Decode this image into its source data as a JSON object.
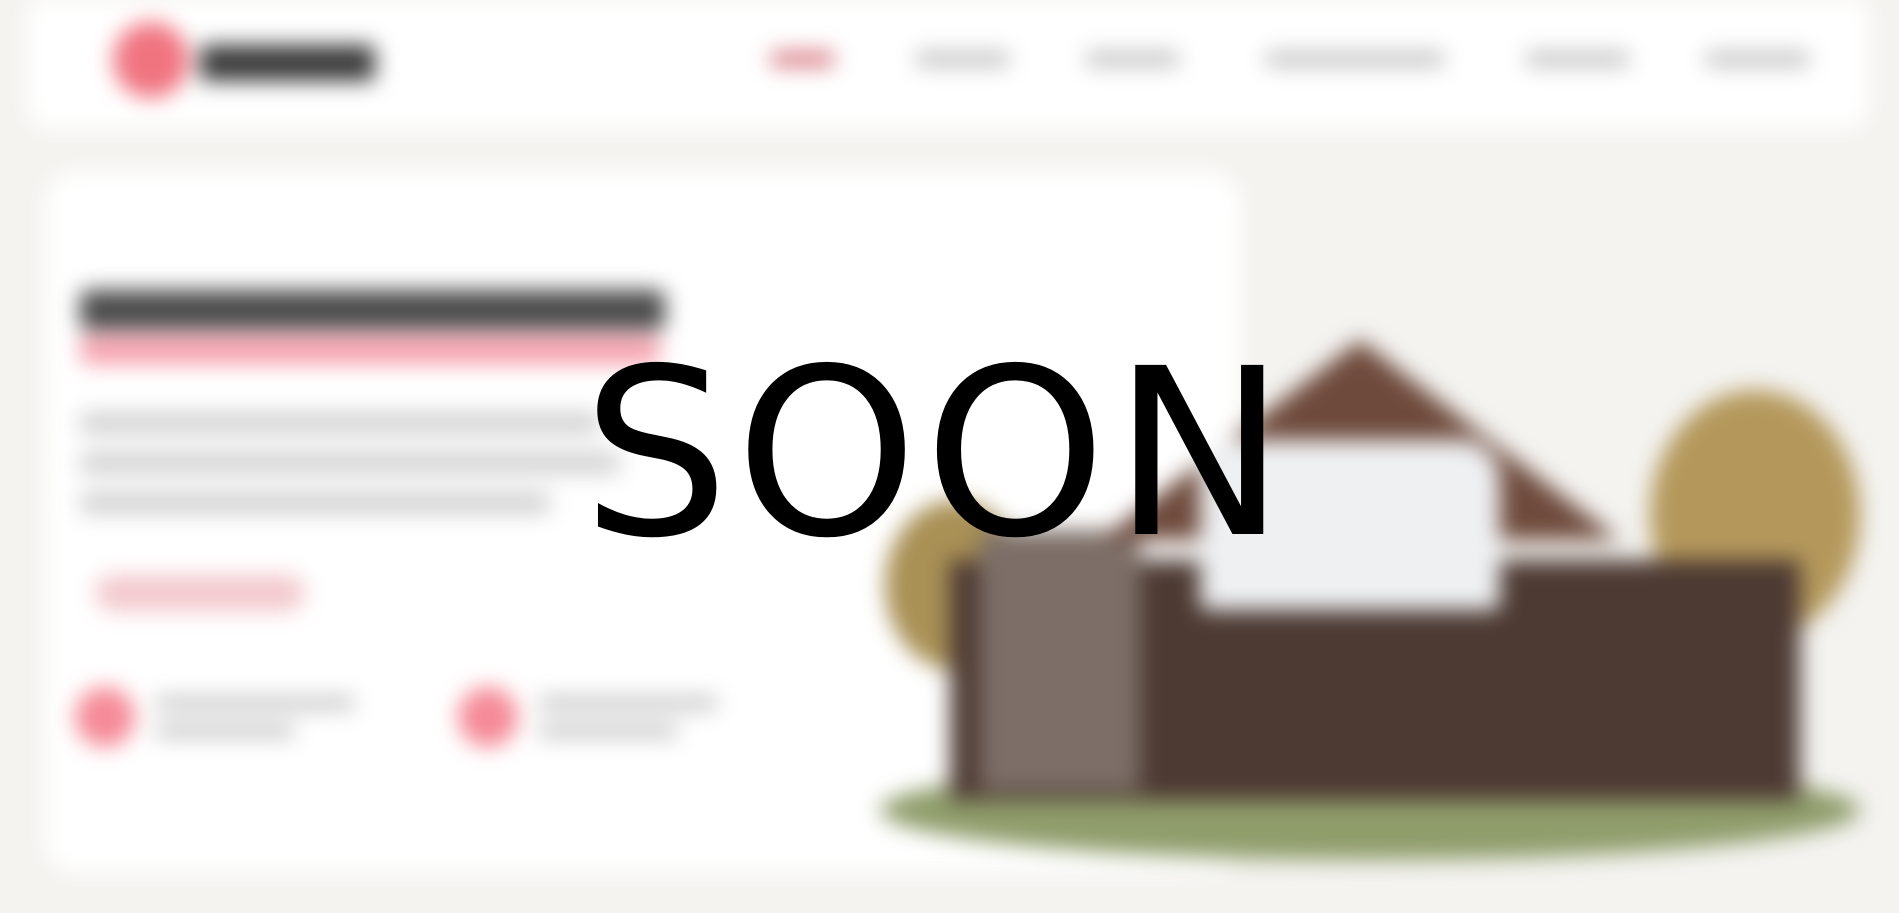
{
  "overlay": {
    "text": "SOON"
  },
  "colors": {
    "accent": "#f07480",
    "overlay_text": "#000000",
    "page_background": "#f4f3f0",
    "card_background": "#ffffff"
  },
  "icons": {
    "logo": "logo-mark",
    "feature_1": "feature-icon",
    "feature_2": "feature-icon"
  }
}
